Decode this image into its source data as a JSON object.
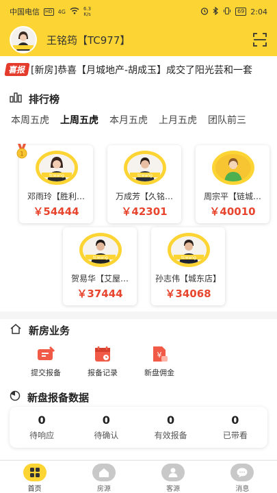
{
  "status_bar": {
    "carrier": "中国电信",
    "hd": "HD",
    "net": "4G",
    "speed_value": "6.3",
    "speed_unit": "K/s",
    "battery": "69",
    "time": "2:04"
  },
  "header": {
    "user_name": "王铭筠【TC977】"
  },
  "news": {
    "badge": "喜报",
    "text": "[新房]恭喜【月城地产-胡成玉】成交了阳光芸和一套"
  },
  "ranking": {
    "title": "排行榜",
    "tabs": [
      "本周五虎",
      "上周五虎",
      "本月五虎",
      "上月五虎",
      "团队前三"
    ],
    "active_tab": "上周五虎",
    "cards": [
      {
        "name": "邓雨玲【胜利…",
        "amount": "￥54444",
        "rank": "1",
        "photo_text": "tcwang"
      },
      {
        "name": "万成芳【久铭…",
        "amount": "￥42301",
        "photo_text": "tcwang"
      },
      {
        "name": "周宗平【链城…",
        "amount": "￥40010"
      },
      {
        "name": "贺易华【艾屋…",
        "amount": "￥37444",
        "photo_text": "tcwang"
      },
      {
        "name": "孙志伟【城东店】",
        "amount": "￥34068",
        "photo_text": "tcwang"
      }
    ]
  },
  "new_house": {
    "title": "新房业务",
    "items": [
      {
        "label": "提交报备",
        "icon": "submit-report-icon"
      },
      {
        "label": "报备记录",
        "icon": "report-record-icon"
      },
      {
        "label": "新盘佣金",
        "icon": "commission-icon"
      }
    ]
  },
  "report_data": {
    "title": "新盘报备数据",
    "stats": [
      {
        "value": "0",
        "label": "待响应"
      },
      {
        "value": "0",
        "label": "待确认"
      },
      {
        "value": "0",
        "label": "有效报备"
      },
      {
        "value": "0",
        "label": "已带看"
      }
    ]
  },
  "tabbar": {
    "items": [
      {
        "label": "首页",
        "active": true
      },
      {
        "label": "房源",
        "active": false
      },
      {
        "label": "客源",
        "active": false
      },
      {
        "label": "消息",
        "active": false
      }
    ]
  },
  "colors": {
    "brand_yellow": "#fcd535",
    "accent_red": "#e8452e"
  }
}
